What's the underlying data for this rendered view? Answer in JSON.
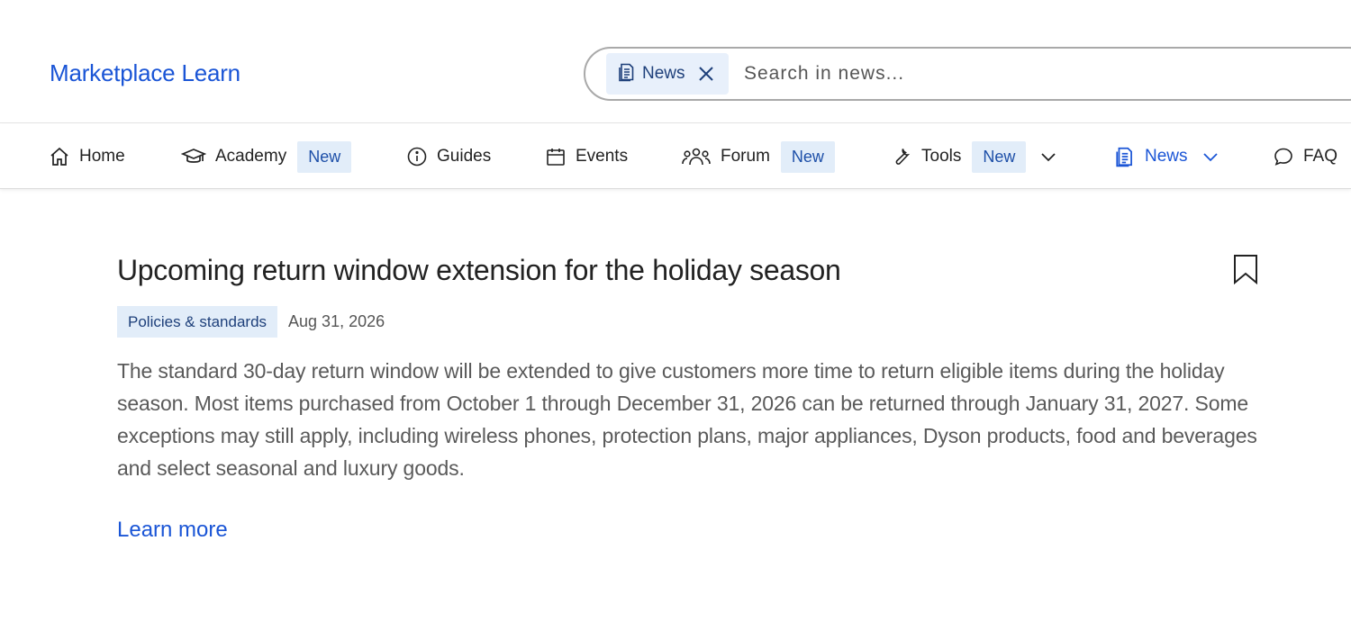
{
  "header": {
    "brand": "Marketplace Learn",
    "search": {
      "chip_label": "News",
      "placeholder": "Search in news..."
    }
  },
  "nav": {
    "items": [
      {
        "label": "Home",
        "icon": "home-icon"
      },
      {
        "label": "Academy",
        "icon": "graduation-cap-icon",
        "badge": "New"
      },
      {
        "label": "Guides",
        "icon": "info-icon"
      },
      {
        "label": "Events",
        "icon": "calendar-icon"
      },
      {
        "label": "Forum",
        "icon": "people-icon",
        "badge": "New"
      },
      {
        "label": "Tools",
        "icon": "wrench-icon",
        "badge": "New"
      },
      {
        "label": "News",
        "icon": "news-icon",
        "active": true
      },
      {
        "label": "FAQ",
        "icon": "chat-bubble-icon"
      }
    ]
  },
  "article": {
    "title": "Upcoming return window extension for the holiday season",
    "category": "Policies & standards",
    "date": "Aug 31, 2026",
    "body": "The standard 30-day return window will be extended to give customers more time to return eligible items during the holiday season. Most items purchased from October 1 through December 31, 2026 can be returned through January 31, 2027. Some exceptions may still apply, including wireless phones, protection plans, major appliances, Dyson products, food and beverages and select seasonal and luxury goods.",
    "link_label": "Learn more"
  },
  "colors": {
    "brand": "#1a55d6",
    "badge_bg": "#e2edf9",
    "text_muted": "#5a5a5a"
  }
}
